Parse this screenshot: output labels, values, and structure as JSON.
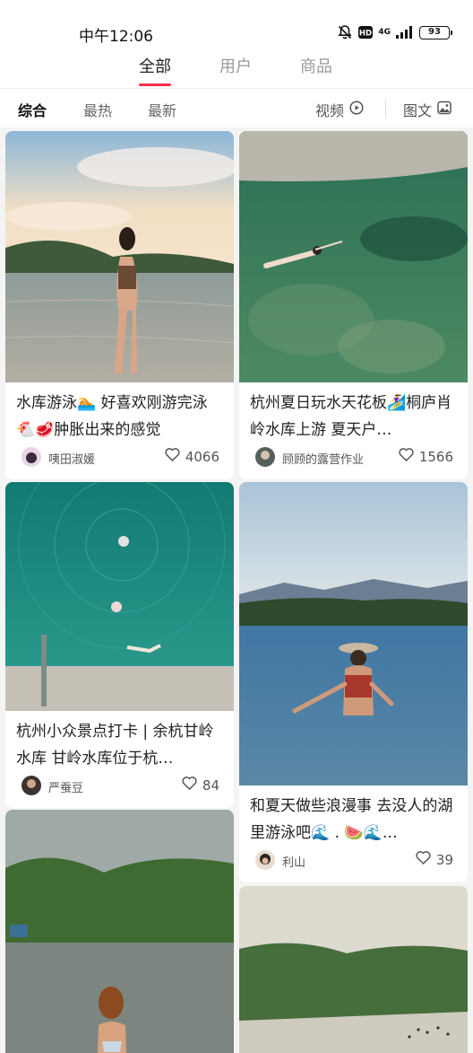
{
  "status_bar": {
    "time": "中午12:06",
    "network": "4G",
    "signal_sub": "HD",
    "battery": "93"
  },
  "main_tabs": [
    {
      "label": "全部"
    },
    {
      "label": "用户"
    },
    {
      "label": "商品"
    }
  ],
  "filters": {
    "sort": [
      {
        "label": "综合"
      },
      {
        "label": "最热"
      },
      {
        "label": "最新"
      }
    ],
    "video_label": "视频",
    "image_text_label": "图文"
  },
  "feed": [
    {
      "title": "水库游泳🏊 好喜欢刚游完泳🐔🥩肿胀出来的感觉",
      "author": "咦田淑媛",
      "likes": "4066"
    },
    {
      "title": "杭州夏日玩水天花板🏄‍♀️桐庐肖岭水库上游 夏天户…",
      "author": "顾顾的露营作业",
      "likes": "1566"
    },
    {
      "title": "杭州小众景点打卡 | 余杭甘岭水库 甘岭水库位于杭…",
      "author": "严蚕豆",
      "likes": "84"
    },
    {
      "title": "和夏天做些浪漫事 去没人的湖里游泳吧🌊 . 🍉🌊…",
      "author": "利山",
      "likes": "39"
    }
  ],
  "colors": {
    "accent": "#ff2e4d",
    "background": "#f4f4f4"
  }
}
